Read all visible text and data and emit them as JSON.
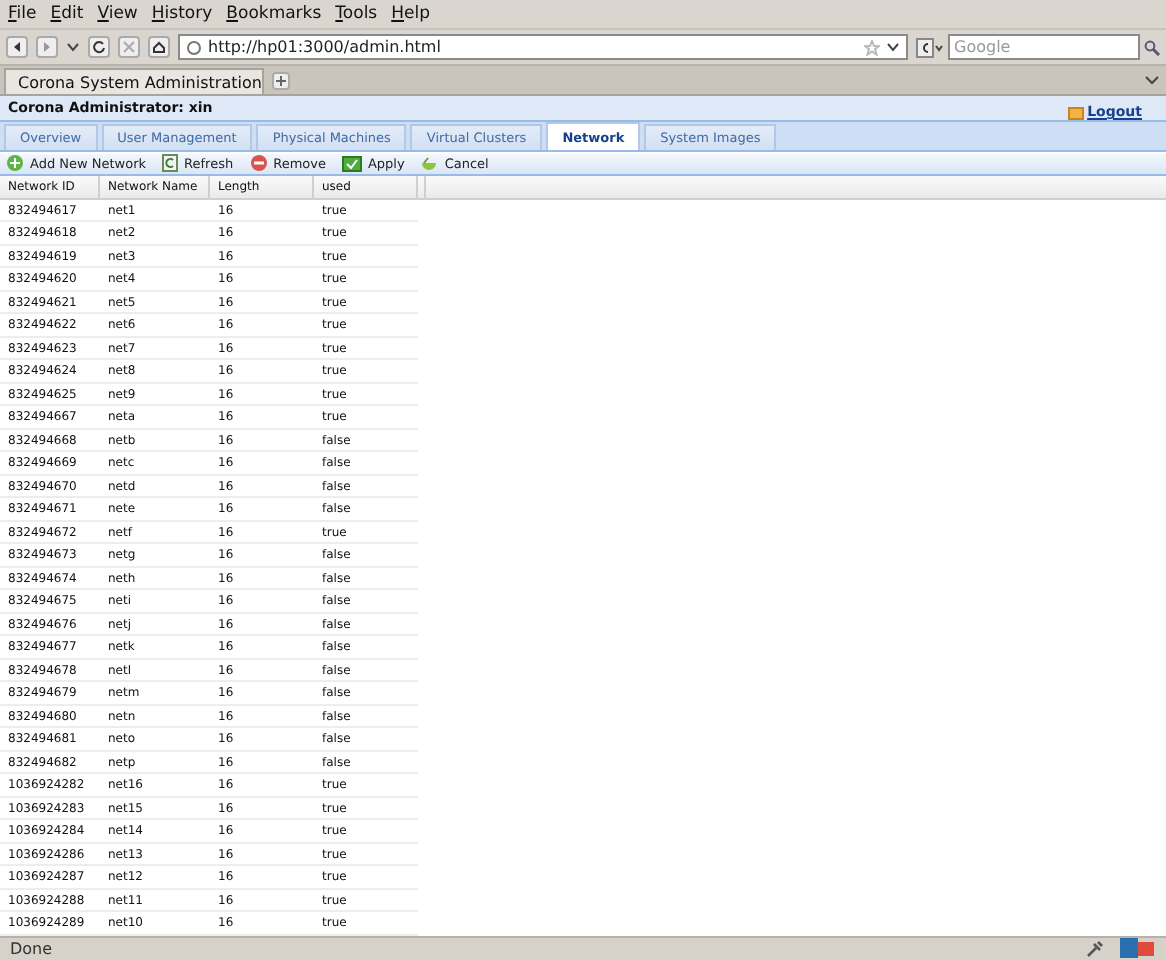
{
  "menu": [
    "File",
    "Edit",
    "View",
    "History",
    "Bookmarks",
    "Tools",
    "Help"
  ],
  "address": {
    "value": "http://hp01:3000/admin.html"
  },
  "search": {
    "placeholder": "Google"
  },
  "browser_tab": {
    "title": "Corona System Administration"
  },
  "header": {
    "title": "Corona Administrator: xin",
    "logout": "Logout"
  },
  "tabs": [
    {
      "label": "Overview",
      "selected": false
    },
    {
      "label": "User Management",
      "selected": false
    },
    {
      "label": "Physical Machines",
      "selected": false
    },
    {
      "label": "Virtual Clusters",
      "selected": false
    },
    {
      "label": "Network",
      "selected": true
    },
    {
      "label": "System Images",
      "selected": false
    }
  ],
  "actions": [
    {
      "kind": "add",
      "label": "Add New Network"
    },
    {
      "kind": "refresh",
      "label": "Refresh"
    },
    {
      "kind": "remove",
      "label": "Remove"
    },
    {
      "kind": "apply",
      "label": "Apply"
    },
    {
      "kind": "cancel",
      "label": "Cancel"
    }
  ],
  "table": {
    "columns": [
      "Network ID",
      "Network Name",
      "Length",
      "used"
    ],
    "rows": [
      [
        "832494617",
        "net1",
        "16",
        "true"
      ],
      [
        "832494618",
        "net2",
        "16",
        "true"
      ],
      [
        "832494619",
        "net3",
        "16",
        "true"
      ],
      [
        "832494620",
        "net4",
        "16",
        "true"
      ],
      [
        "832494621",
        "net5",
        "16",
        "true"
      ],
      [
        "832494622",
        "net6",
        "16",
        "true"
      ],
      [
        "832494623",
        "net7",
        "16",
        "true"
      ],
      [
        "832494624",
        "net8",
        "16",
        "true"
      ],
      [
        "832494625",
        "net9",
        "16",
        "true"
      ],
      [
        "832494667",
        "neta",
        "16",
        "true"
      ],
      [
        "832494668",
        "netb",
        "16",
        "false"
      ],
      [
        "832494669",
        "netc",
        "16",
        "false"
      ],
      [
        "832494670",
        "netd",
        "16",
        "false"
      ],
      [
        "832494671",
        "nete",
        "16",
        "false"
      ],
      [
        "832494672",
        "netf",
        "16",
        "true"
      ],
      [
        "832494673",
        "netg",
        "16",
        "false"
      ],
      [
        "832494674",
        "neth",
        "16",
        "false"
      ],
      [
        "832494675",
        "neti",
        "16",
        "false"
      ],
      [
        "832494676",
        "netj",
        "16",
        "false"
      ],
      [
        "832494677",
        "netk",
        "16",
        "false"
      ],
      [
        "832494678",
        "netl",
        "16",
        "false"
      ],
      [
        "832494679",
        "netm",
        "16",
        "false"
      ],
      [
        "832494680",
        "netn",
        "16",
        "false"
      ],
      [
        "832494681",
        "neto",
        "16",
        "false"
      ],
      [
        "832494682",
        "netp",
        "16",
        "false"
      ],
      [
        "1036924282",
        "net16",
        "16",
        "true"
      ],
      [
        "1036924283",
        "net15",
        "16",
        "true"
      ],
      [
        "1036924284",
        "net14",
        "16",
        "true"
      ],
      [
        "1036924286",
        "net13",
        "16",
        "true"
      ],
      [
        "1036924287",
        "net12",
        "16",
        "true"
      ],
      [
        "1036924288",
        "net11",
        "16",
        "true"
      ],
      [
        "1036924289",
        "net10",
        "16",
        "true"
      ]
    ]
  },
  "status_bar": {
    "text": "Done"
  }
}
